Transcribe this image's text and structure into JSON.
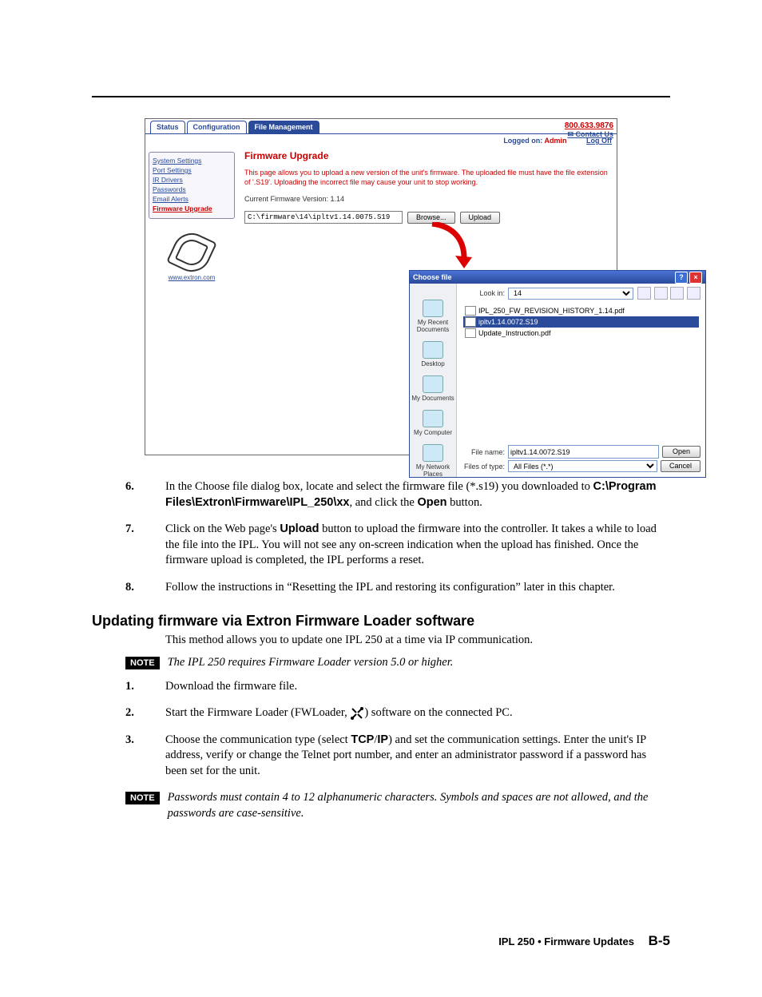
{
  "screenshot": {
    "tabs": {
      "status": "Status",
      "configuration": "Configuration",
      "file_management": "File Management"
    },
    "phone": "800.633.9876",
    "contact": "Contact Us",
    "logged_on_label": "Logged on:",
    "logged_on_user": "Admin",
    "logoff": "Log Off",
    "sidebar": {
      "items": {
        "system_settings": "System Settings",
        "port_settings": "Port Settings",
        "ir_drivers": "IR Drivers",
        "passwords": "Passwords",
        "email_alerts": "Email Alerts",
        "firmware_upgrade": "Firmware Upgrade"
      },
      "url": "www.extron.com"
    },
    "main": {
      "title": "Firmware Upgrade",
      "desc": "This page allows you to upload a new version of the unit's firmware. The uploaded file must have the file extension of '.S19'. Uploading the incorrect file may cause your unit to stop working.",
      "current_version": "Current Firmware Version: 1.14",
      "file_path": "C:\\firmware\\14\\ipltv1.14.0075.S19",
      "browse": "Browse...",
      "upload": "Upload"
    },
    "dialog": {
      "title": "Choose file",
      "look_in_label": "Look in:",
      "look_in_value": "14",
      "places": {
        "recent": "My Recent Documents",
        "desktop": "Desktop",
        "mydocs": "My Documents",
        "mycomputer": "My Computer",
        "network": "My Network Places"
      },
      "files": {
        "f1": "IPL_250_FW_REVISION_HISTORY_1.14.pdf",
        "f2": "ipltv1.14.0072.S19",
        "f3": "Update_Instruction.pdf"
      },
      "file_name_label": "File name:",
      "file_name_value": "ipltv1.14.0072.S19",
      "file_type_label": "Files of type:",
      "file_type_value": "All Files (*.*)",
      "open": "Open",
      "cancel": "Cancel"
    }
  },
  "steps": {
    "s6": {
      "num": "6.",
      "pre": "In the Choose file dialog box, locate and select the firmware file (*.s19) you downloaded to ",
      "path": "C:\\Program Files\\Extron\\Firmware\\IPL_250\\xx",
      "mid": ", and click the ",
      "btn": "Open",
      "post": " button."
    },
    "s7": {
      "num": "7.",
      "pre": "Click on the Web page's ",
      "btn": "Upload",
      "post": " button to upload the firmware into the controller.  It takes a while to load the file into the IPL.  You will not see any on-screen indication when the upload has finished.  Once the firmware upload is completed, the IPL performs a reset."
    },
    "s8": {
      "num": "8.",
      "text": "Follow the instructions in “Resetting the IPL and restoring its configuration” later in this chapter."
    }
  },
  "section2": {
    "heading": "Updating firmware via Extron Firmware Loader software",
    "intro": "This method allows you to update one IPL 250 at a time via IP communication.",
    "note1_label": "NOTE",
    "note1": "The IPL 250 requires Firmware Loader version 5.0 or higher.",
    "s1": {
      "num": "1.",
      "text": "Download the firmware file."
    },
    "s2": {
      "num": "2.",
      "pre": "Start the Firmware Loader (FWLoader, ",
      "post": ") software on the connected PC."
    },
    "s3": {
      "num": "3.",
      "pre": "Choose the communication type (select ",
      "b1": "TCP",
      "slash": "/",
      "b2": "IP",
      "post": ") and set the communication settings.  Enter the unit's IP address, verify or change the Telnet port number, and enter an administrator password if a password has been set for the unit."
    },
    "note2_label": "NOTE",
    "note2": "Passwords must contain 4 to 12 alphanumeric characters.  Symbols and spaces are not allowed, and the passwords are case-sensitive."
  },
  "footer": {
    "product": "IPL 250 • Firmware Updates",
    "page": "B-5"
  }
}
